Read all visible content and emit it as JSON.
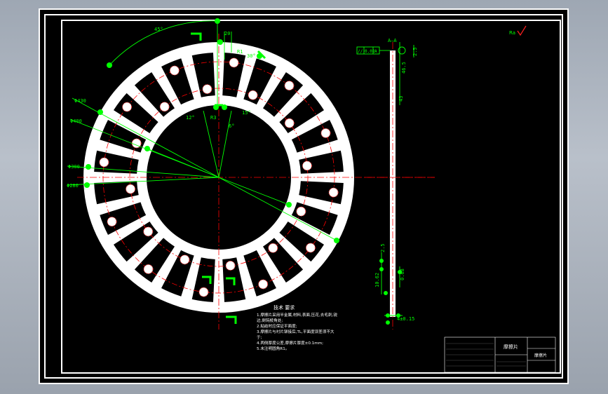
{
  "drawing": {
    "section_label": "A—A",
    "diameter_labels": [
      "Φ430",
      "Φ400",
      "Φ300",
      "Φ280"
    ],
    "angle_labels": [
      "45°",
      "12°",
      "15°",
      "30°",
      "6°"
    ],
    "dimension_labels": [
      "20",
      "R1",
      "R3",
      "2.5",
      "46.5",
      "43"
    ],
    "section_dims": [
      "10.62",
      "0.68",
      "2.5",
      "4±0.15"
    ],
    "tolerance_frame": [
      "//",
      "0.02",
      "A"
    ],
    "notes": {
      "title": "技术 要求",
      "lines": [
        "1.摩擦片采用半金属,材料,表面,压花,去毛刺,锐",
        "边,倒钝棱角处;",
        "2.粘结时应保证平面度;",
        "3.摩擦片与衬片铆接后,TL,平面度误差须不大",
        "于;",
        "4.两侧厚度公差,摩擦片厚度±0.1mm;",
        "5.未注明圆角R1。"
      ]
    },
    "title_block": {
      "name": "摩擦片",
      "code": "摩擦片"
    }
  },
  "colors": {
    "background": "#000000",
    "part": "#ffffff",
    "dimension": "#00ff00",
    "centerline": "#ff0000"
  }
}
